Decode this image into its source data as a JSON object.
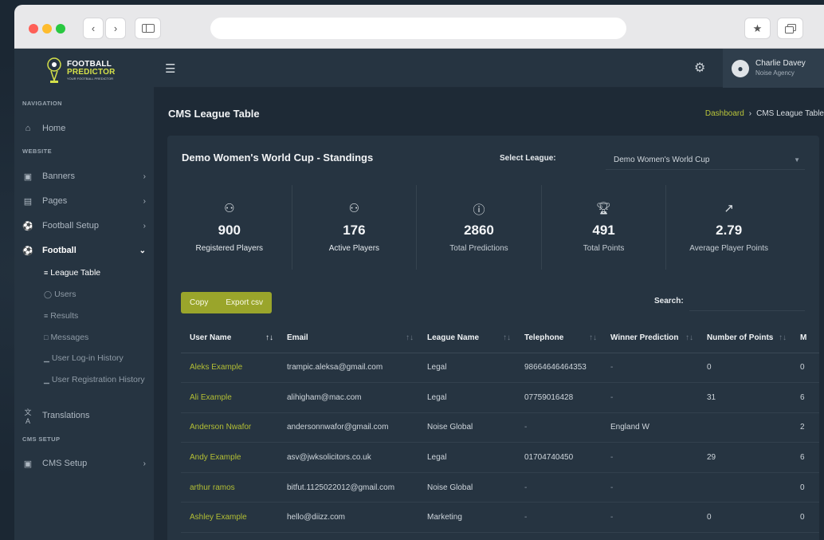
{
  "colors": {
    "accent": "#9aa52b",
    "link": "#b3bf34",
    "bg": "#1e2a36",
    "card": "#263441"
  },
  "app": {
    "logo": {
      "line1": "FOOTBALL",
      "line2": "PREDICTOR",
      "line3": "YOUR FOOTBALL PREDICTOR"
    }
  },
  "sidebar": {
    "sections": {
      "navigation": "NAVIGATION",
      "website": "WEBSITE",
      "cms_setup": "CMS SETUP"
    },
    "items": [
      {
        "label": "Home",
        "icon": "home-icon"
      },
      {
        "label": "Banners",
        "icon": "image-icon"
      },
      {
        "label": "Pages",
        "icon": "page-icon"
      },
      {
        "label": "Football Setup",
        "icon": "ball-icon"
      },
      {
        "label": "Football",
        "icon": "ball-icon"
      },
      {
        "label": "Translations",
        "icon": "translate-icon"
      },
      {
        "label": "CMS Setup",
        "icon": "settings-box-icon"
      }
    ],
    "football_sub": [
      {
        "label": "League Table"
      },
      {
        "label": "Users"
      },
      {
        "label": "Results"
      },
      {
        "label": "Messages"
      },
      {
        "label": "User Log-in History"
      },
      {
        "label": "User Registration History"
      }
    ]
  },
  "topbar": {
    "user_name": "Charlie Davey",
    "user_org": "Noise Agency"
  },
  "page": {
    "title": "CMS League Table",
    "breadcrumb": {
      "home": "Dashboard",
      "current": "CMS League Table"
    }
  },
  "card": {
    "title": "Demo Women's World Cup - Standings",
    "select_label": "Select League:",
    "select_value": "Demo Women's World Cup"
  },
  "stats": [
    {
      "value": "900",
      "label": "Registered Players",
      "icon": "users-icon"
    },
    {
      "value": "176",
      "label": "Active Players",
      "icon": "users-icon"
    },
    {
      "value": "2860",
      "label": "Total Predictions",
      "icon": "question-icon"
    },
    {
      "value": "491",
      "label": "Total Points",
      "icon": "trophy-icon"
    },
    {
      "value": "2.79",
      "label": "Average Player Points",
      "icon": "trend-icon"
    }
  ],
  "toolbar": {
    "copy": "Copy",
    "export": "Export csv",
    "search_label": "Search:"
  },
  "table": {
    "headers": [
      "User Name",
      "Email",
      "League Name",
      "Telephone",
      "Winner Prediction",
      "Number of Points",
      "M"
    ],
    "rows": [
      [
        "Aleks Example",
        "trampic.aleksa@gmail.com",
        "Legal",
        "98664646464353",
        "-",
        "0",
        "0"
      ],
      [
        "Ali Example",
        "alihigham@mac.com",
        "Legal",
        "07759016428",
        "-",
        "31",
        "6"
      ],
      [
        "Anderson Nwafor",
        "andersonnwafor@gmail.com",
        "Noise Global",
        "-",
        "England W",
        "",
        "2"
      ],
      [
        "Andy Example",
        "asv@jwksolicitors.co.uk",
        "Legal",
        "01704740450",
        "-",
        "29",
        "6"
      ],
      [
        "arthur ramos",
        "bitfut.1125022012@gmail.com",
        "Noise Global",
        "-",
        "-",
        "",
        "0"
      ],
      [
        "Ashley Example",
        "hello@diizz.com",
        "Marketing",
        "-",
        "-",
        "0",
        "0"
      ]
    ]
  }
}
